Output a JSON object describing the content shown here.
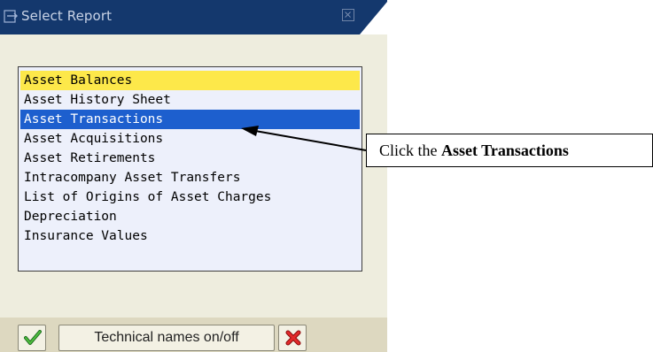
{
  "dialog": {
    "title": "Select Report",
    "reports": [
      "Asset Balances",
      "Asset History Sheet",
      "Asset Transactions",
      "Asset Acquisitions",
      "Asset Retirements",
      "Intracompany Asset Transfers",
      "List of Origins of Asset Charges",
      "Depreciation",
      "Insurance Values"
    ]
  },
  "toolbar": {
    "technical_names_label": "Technical names on/off"
  },
  "annotation": {
    "prefix": "Click the",
    "target": "Asset Transactions"
  },
  "colors": {
    "titlebar": "#14386d",
    "body": "#eeedde",
    "list_background": "#edf0fb",
    "focus_highlight": "#fde84a",
    "selection_highlight": "#1d5fce",
    "confirm_green": "#2e8b2e",
    "cancel_red": "#d21c1c"
  }
}
